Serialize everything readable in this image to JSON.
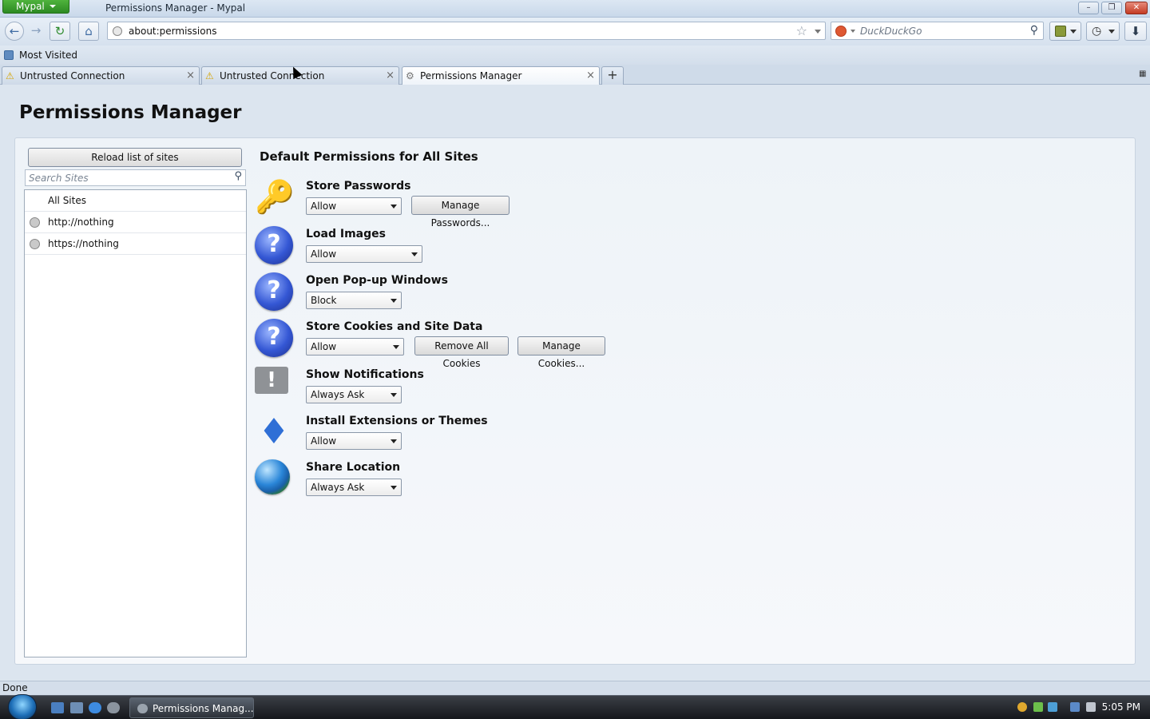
{
  "window": {
    "app_menu": "Mypal",
    "title": "Permissions Manager - Mypal",
    "controls": [
      "minimize",
      "restore",
      "close"
    ]
  },
  "navbar": {
    "url": "about:permissions",
    "search_placeholder": "DuckDuckGo",
    "buttons": [
      "back",
      "forward",
      "reload",
      "home",
      "bookmarks",
      "history",
      "downloads"
    ]
  },
  "bookmarks": {
    "items": [
      {
        "label": "Most Visited"
      }
    ]
  },
  "tabs": [
    {
      "label": "Untrusted Connection",
      "icon": "warning-icon",
      "active": false
    },
    {
      "label": "Untrusted Connection",
      "icon": "warning-icon",
      "active": false
    },
    {
      "label": "Permissions Manager",
      "icon": "gear-icon",
      "active": true
    }
  ],
  "page": {
    "title": "Permissions Manager",
    "sidebar": {
      "reload_label": "Reload list of sites",
      "search_placeholder": "Search Sites",
      "sites": [
        {
          "label": "All Sites",
          "icon": ""
        },
        {
          "label": "http://nothing",
          "icon": "site-icon"
        },
        {
          "label": "https://nothing",
          "icon": "site-icon"
        }
      ]
    },
    "main": {
      "heading": "Default Permissions for All Sites",
      "permissions": [
        {
          "label": "Store Passwords",
          "icon": "key-icon",
          "value": "Allow",
          "buttons": [
            "Manage Passwords..."
          ]
        },
        {
          "label": "Load Images",
          "icon": "question-icon",
          "value": "Allow",
          "buttons": []
        },
        {
          "label": "Open Pop-up Windows",
          "icon": "question-icon",
          "value": "Block",
          "buttons": []
        },
        {
          "label": "Store Cookies and Site Data",
          "icon": "question-icon",
          "value": "Allow",
          "buttons": [
            "Remove All Cookies",
            "Manage Cookies..."
          ]
        },
        {
          "label": "Show Notifications",
          "icon": "notification-icon",
          "value": "Always Ask",
          "buttons": []
        },
        {
          "label": "Install Extensions or Themes",
          "icon": "puzzle-icon",
          "value": "Allow",
          "buttons": []
        },
        {
          "label": "Share Location",
          "icon": "globe-icon",
          "value": "Always Ask",
          "buttons": []
        }
      ]
    }
  },
  "status": {
    "text": "Done"
  },
  "taskbar": {
    "item_label": "Permissions Manag...",
    "clock": "5:05 PM"
  },
  "colors": {
    "content_bg": "#dce5ef",
    "accent_blue": "#3457d4",
    "app_button_green": "#2c8a22"
  }
}
